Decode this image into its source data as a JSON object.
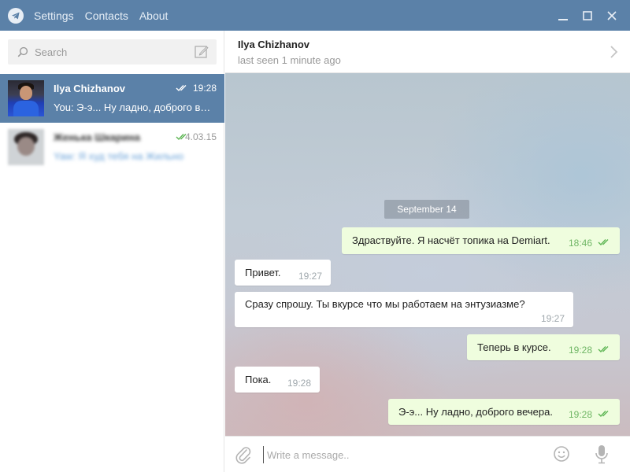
{
  "menu": {
    "logo_icon": "telegram-plane-icon",
    "items": [
      {
        "label": "Settings"
      },
      {
        "label": "Contacts"
      },
      {
        "label": "About"
      }
    ]
  },
  "window_controls": {
    "minimize_icon": "minimize-icon",
    "maximize_icon": "maximize-icon",
    "close_icon": "close-icon"
  },
  "search": {
    "placeholder": "Search",
    "icon": "search-icon",
    "compose_icon": "compose-icon"
  },
  "dialogs": [
    {
      "name": "Ilya Chizhanov",
      "preview": "You: Э-э... Ну ладно, доброго вечера.",
      "time": "19:28",
      "read": true,
      "active": true,
      "blurred": false
    },
    {
      "name": "Женька Шкарина",
      "preview": "Yaw: Я худ тебя на Жильно",
      "time": "4.03.15",
      "read": true,
      "active": false,
      "blurred": true
    }
  ],
  "chat": {
    "peer_name": "Ilya Chizhanov",
    "peer_status": "last seen 1 minute ago",
    "header_arrow_icon": "chevron-right-icon",
    "date_badge": "September 14",
    "messages": [
      {
        "dir": "out",
        "text": "Здраствуйте. Я насчёт топика на Demiart.",
        "time": "18:46",
        "read": true
      },
      {
        "dir": "in",
        "text": "Привет.",
        "time": "19:27"
      },
      {
        "dir": "in",
        "text": "Сразу спрошу. Ты вкурсе что мы работаем на энтузиазме?",
        "time": "19:27"
      },
      {
        "dir": "out",
        "text": "Теперь в курсе.",
        "time": "19:28",
        "read": true
      },
      {
        "dir": "in",
        "text": "Пока.",
        "time": "19:28"
      },
      {
        "dir": "out",
        "text": "Э-э... Ну ладно, доброго вечера.",
        "time": "19:28",
        "read": true
      }
    ]
  },
  "composer": {
    "placeholder": "Write a message..",
    "attach_icon": "paperclip-icon",
    "emoji_icon": "emoji-icon",
    "mic_icon": "microphone-icon"
  },
  "colors": {
    "accent": "#5b81a8",
    "out_bubble": "#effdde",
    "read_check": "#5db553"
  }
}
